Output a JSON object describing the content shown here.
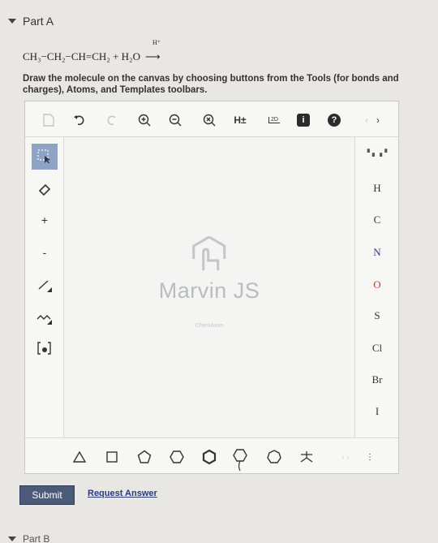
{
  "part": {
    "title": "Part A",
    "next_title": "Part B"
  },
  "equation": {
    "reactant": "CH₃−CH₂−CH=CH₂ + H₂O",
    "catalyst": "H⁺",
    "arrow": "⟶"
  },
  "instructions": "Draw the molecule on the canvas by choosing buttons from the Tools (for bonds and charges), Atoms, and Templates toolbars.",
  "toolbar_top": {
    "new_icon": "document-icon",
    "undo_icon": "undo-icon",
    "redo_icon": "redo-icon",
    "zoom_in_icon": "zoom-in-icon",
    "zoom_out_icon": "zoom-out-icon",
    "zoom_reset_icon": "zoom-reset-icon",
    "hydrogens_label": "H±",
    "clean_2d_label": "2D",
    "info_label": "i",
    "help_label": "?",
    "nav_left": "‹",
    "nav_right": "›"
  },
  "toolbar_left": {
    "plus_label": "+",
    "minus_label": "-"
  },
  "toolbar_right": {
    "atoms": [
      "H",
      "C",
      "N",
      "O",
      "S",
      "Cl",
      "Br",
      "I"
    ]
  },
  "watermark": {
    "brand": "Marvin JS",
    "vendor": "ChemAxon"
  },
  "actions": {
    "submit_label": "Submit",
    "request_label": "Request Answer"
  },
  "colors": {
    "submit_bg": "#4a5a78",
    "selected_tool": "#8fa3c4",
    "oxygen": "#c0392b",
    "nitrogen": "#2c3e8c"
  }
}
